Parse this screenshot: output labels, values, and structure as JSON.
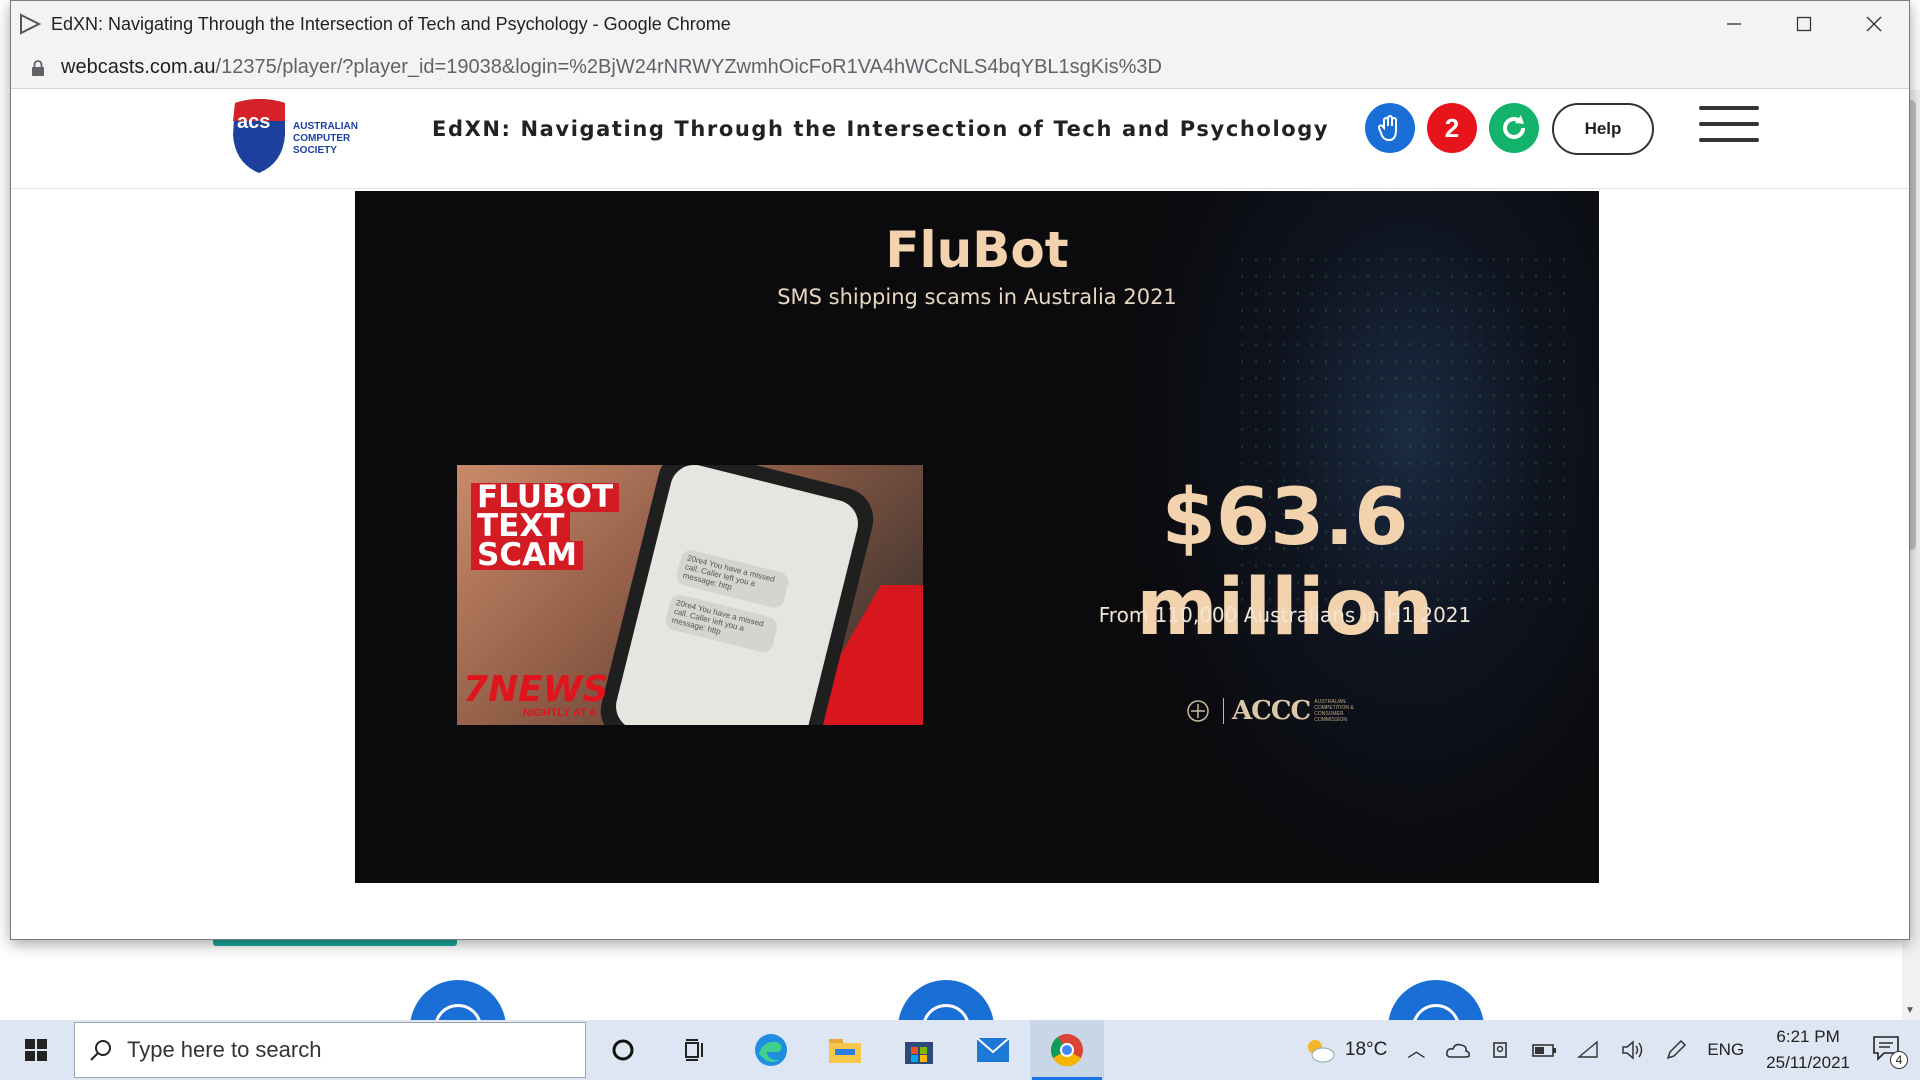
{
  "window": {
    "title": "EdXN: Navigating Through the Intersection of Tech and Psychology - Google Chrome",
    "url_host": "webcasts.com.au",
    "url_path": "/12375/player/?player_id=19038&login=%2BjW24rNRWYZwmhOicFoR1VA4hWCcNLS4bqYBL1sgKis%3D"
  },
  "header": {
    "logo_abbr": "acs",
    "logo_line1": "AUSTRALIAN",
    "logo_line2": "COMPUTER",
    "logo_line3": "SOCIETY",
    "event_title": "EdXN: Navigating Through the Intersection of Tech and Psychology",
    "notification_count": "2",
    "help_label": "Help"
  },
  "slide": {
    "title": "FluBot",
    "subtitle": "SMS shipping scams in Australia 2021",
    "big_number": "$63.6 million",
    "from_text": "From 110,000 Australians in H1 2021",
    "agency": "ACCC",
    "agency_full": "AUSTRALIAN COMPETITION & CONSUMER COMMISSION",
    "news_label_1": "FLUBOT",
    "news_label_2": "TEXT",
    "news_label_3": "SCAM",
    "news_brand": "7NEWS",
    "news_tagline": "NIGHTLY AT 6",
    "sms_1": "20re4 You have a missed call. Caller left you a message: http",
    "sms_2": "20re4 You have a missed call. Caller left you a message: http"
  },
  "taskbar": {
    "search_placeholder": "Type here to search",
    "temperature": "18°C",
    "language": "ENG",
    "time": "6:21 PM",
    "date": "25/11/2021",
    "notification_badge": "4"
  },
  "colors": {
    "accent_blue": "#1a6fd6",
    "notification_red": "#e8141b",
    "refresh_green": "#14b36b",
    "slide_gold": "#f2d3ae"
  }
}
